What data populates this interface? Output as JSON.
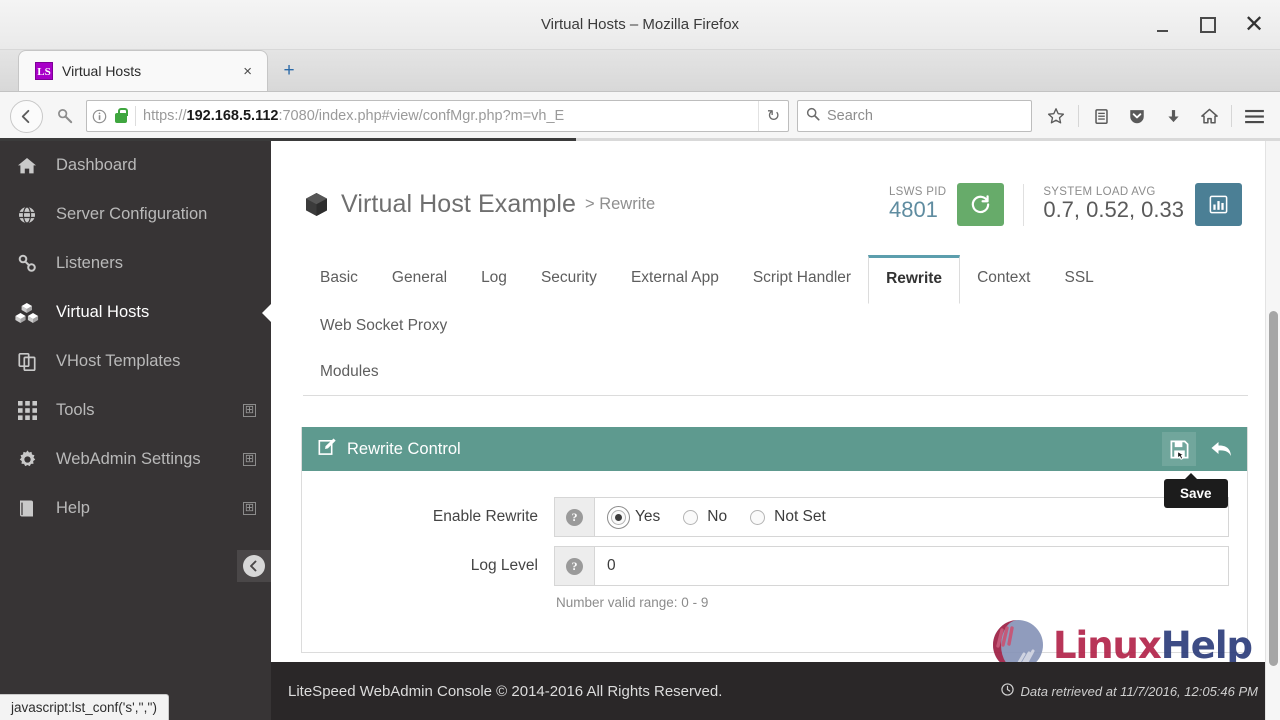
{
  "browser": {
    "window_title": "Virtual Hosts – Mozilla Firefox",
    "minimize_label": "Minimize",
    "maximize_label": "Maximize",
    "close_label": "Close",
    "tab": {
      "title": "Virtual Hosts",
      "favicon_text": "LS",
      "close_label": "×"
    },
    "new_tab_label": "+",
    "back_label": "←",
    "forward_label": "→",
    "url_prefix": "https://",
    "url_host": "192.168.5.112",
    "url_rest": ":7080/index.php#view/confMgr.php?m=vh_E",
    "reload_label": "↻",
    "search_placeholder": "Search",
    "toolbar_icons": [
      "bookmark-star-icon",
      "library-icon",
      "pocket-icon",
      "downloads-icon",
      "home-icon",
      "menu-icon"
    ],
    "status_text": "javascript:lst_conf('s','','')"
  },
  "sidebar": {
    "items": [
      {
        "label": "Dashboard",
        "icon": "home-icon",
        "active": false,
        "expandable": false
      },
      {
        "label": "Server Configuration",
        "icon": "globe-icon",
        "active": false,
        "expandable": false
      },
      {
        "label": "Listeners",
        "icon": "link-icon",
        "active": false,
        "expandable": false
      },
      {
        "label": "Virtual Hosts",
        "icon": "cubes-icon",
        "active": true,
        "expandable": false
      },
      {
        "label": "VHost Templates",
        "icon": "copy-icon",
        "active": false,
        "expandable": false
      },
      {
        "label": "Tools",
        "icon": "grid-icon",
        "active": false,
        "expandable": true
      },
      {
        "label": "WebAdmin Settings",
        "icon": "gear-icon",
        "active": false,
        "expandable": true
      },
      {
        "label": "Help",
        "icon": "book-icon",
        "active": false,
        "expandable": true
      }
    ],
    "expand_glyph": "⊞",
    "collapse_label": "←"
  },
  "header": {
    "icon": "cube-icon",
    "title": "Virtual Host Example",
    "breadcrumb_sep": ">",
    "breadcrumb_current": "Rewrite",
    "stats": [
      {
        "label": "LSWS PID",
        "value": "4801",
        "button_icon": "restart-icon",
        "button_glyph": "↻",
        "button_color": "#67ab6a"
      },
      {
        "label": "SYSTEM LOAD AVG",
        "value": "0.7, 0.52, 0.33",
        "button_icon": "chart-icon",
        "button_glyph": "█",
        "button_color": "#4b7f95"
      }
    ]
  },
  "tabs": {
    "row1": [
      {
        "label": "Basic",
        "active": false
      },
      {
        "label": "General",
        "active": false
      },
      {
        "label": "Log",
        "active": false
      },
      {
        "label": "Security",
        "active": false
      },
      {
        "label": "External App",
        "active": false
      },
      {
        "label": "Script Handler",
        "active": false
      },
      {
        "label": "Rewrite",
        "active": true
      },
      {
        "label": "Context",
        "active": false
      },
      {
        "label": "SSL",
        "active": false
      },
      {
        "label": "Web Socket Proxy",
        "active": false
      }
    ],
    "row2": [
      {
        "label": "Modules",
        "active": false
      }
    ]
  },
  "panel": {
    "icon": "edit-icon",
    "title": "Rewrite Control",
    "actions": [
      {
        "name": "save-button",
        "icon": "save-icon",
        "tooltip": "Save"
      },
      {
        "name": "undo-button",
        "icon": "undo-arrow-icon",
        "tooltip": ""
      }
    ],
    "tooltip": "Save",
    "fields": [
      {
        "label": "Enable Rewrite",
        "type": "radio",
        "help_glyph": "?",
        "options": [
          {
            "label": "Yes",
            "selected": true,
            "focused": true
          },
          {
            "label": "No",
            "selected": false,
            "focused": false
          },
          {
            "label": "Not Set",
            "selected": false,
            "focused": false
          }
        ],
        "hint": ""
      },
      {
        "label": "Log Level",
        "type": "text",
        "help_glyph": "?",
        "value": "0",
        "placeholder": "",
        "hint": "Number valid range: 0 - 9"
      }
    ]
  },
  "watermark": {
    "part1": "Linux",
    "part2": "Help"
  },
  "footer": {
    "copyright": "LiteSpeed WebAdmin Console © 2014-2016 All Rights Reserved.",
    "clock_icon": "clock-icon",
    "retrieved": "Data retrieved at 11/7/2016, 12:05:46 PM"
  },
  "colors": {
    "panel_header": "#5e9a8f",
    "sidebar": "#373435",
    "footer": "#2a2728",
    "accent_tab": "#5c9ead",
    "stat_value": "#5f8ca0"
  }
}
